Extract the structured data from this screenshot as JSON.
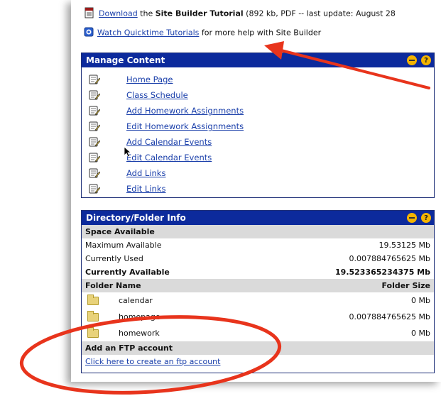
{
  "top": {
    "download_link": "Download",
    "download_text_pre": " the ",
    "download_bold": "Site Builder Tutorial",
    "download_text_post": " (892 kb, PDF -- last update: August 28",
    "quicktime_link": "Watch Quicktime Tutorials",
    "quicktime_text": " for more help with Site Builder"
  },
  "manage_content": {
    "title": "Manage Content",
    "items": [
      {
        "label": "Home Page"
      },
      {
        "label": "Class Schedule"
      },
      {
        "label": "Add Homework Assignments"
      },
      {
        "label": "Edit Homework Assignments"
      },
      {
        "label": "Add Calendar Events"
      },
      {
        "label": "Edit Calendar Events"
      },
      {
        "label": "Add Links"
      },
      {
        "label": "Edit Links"
      }
    ]
  },
  "directory": {
    "title": "Directory/Folder Info",
    "space_header": "Space Available",
    "max_label": "Maximum Available",
    "max_value": "19.53125 Mb",
    "used_label": "Currently Used",
    "used_value": "0.007884765625 Mb",
    "avail_label": "Currently Available",
    "avail_value": "19.523365234375 Mb",
    "folder_name_header": "Folder Name",
    "folder_size_header": "Folder Size",
    "folders": [
      {
        "name": "calendar",
        "size": "0 Mb"
      },
      {
        "name": "homepage",
        "size": "0.007884765625 Mb"
      },
      {
        "name": "homework",
        "size": "0 Mb"
      }
    ],
    "ftp_header": "Add an FTP account",
    "ftp_link": "Click here to create an ftp account"
  },
  "colors": {
    "panel_header": "#0c2a9c",
    "annotation": "#e8341c",
    "header_button": "#f4b400"
  }
}
